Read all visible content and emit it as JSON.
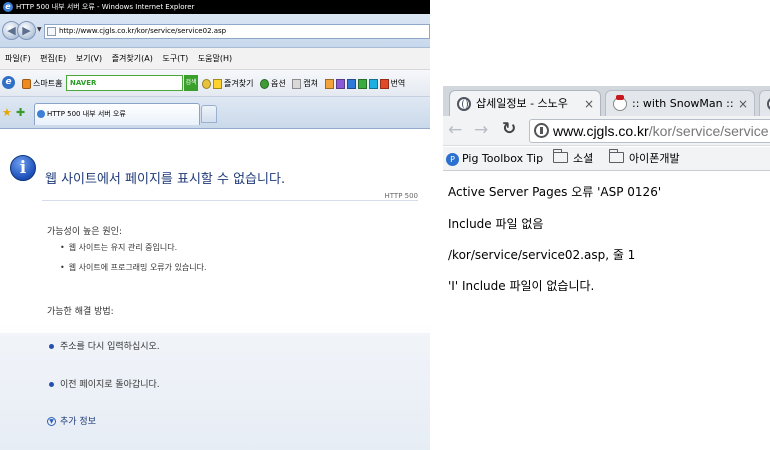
{
  "ie": {
    "title_bar": "HTTP 500 내부 서버 오류 - Windows Internet Explorer",
    "address": "http://www.cjgls.co.kr/kor/service/service02.asp",
    "menu": [
      "파일(F)",
      "편집(E)",
      "보기(V)",
      "즐겨찾기(A)",
      "도구(T)",
      "도움말(H)"
    ],
    "toolbar": {
      "smart_home": "스마트홈",
      "naver_logo": "NAVER",
      "naver_search": "검색",
      "favorites": "즐겨찾기",
      "options": "옵션",
      "capture": "캡쳐",
      "translate": "번역"
    },
    "tab_title": "HTTP 500 내부 서버 오류",
    "page": {
      "heading": "웹 사이트에서 페이지를 표시할 수 없습니다.",
      "http_code": "HTTP 500",
      "causes_label": "가능성이 높은 원인:",
      "causes": [
        "웹 사이트는 유지 관리 중입니다.",
        "웹 사이트에 프로그래밍 오류가 있습니다."
      ],
      "solutions_label": "가능한 해결 방법:",
      "solutions": [
        "주소를 다시 입력하십시오.",
        "이전 페이지로 돌아갑니다."
      ],
      "more_info": "추가 정보"
    }
  },
  "chrome": {
    "tabs": [
      {
        "title": "샵세일정보 - 스노우"
      },
      {
        "title": ":: with SnowMan ::"
      },
      {
        "title": ""
      }
    ],
    "url_host": "www.cjgls.co.kr",
    "url_path": "/kor/service/service",
    "bookmarks": [
      "Pig Toolbox Tip",
      "소셜",
      "아이폰개발"
    ],
    "body_lines": [
      "Active Server Pages 오류 'ASP 0126'",
      "Include 파일 없음",
      "/kor/service/service02.asp, 줄 1",
      "'I' Include 파일이 없습니다."
    ]
  }
}
